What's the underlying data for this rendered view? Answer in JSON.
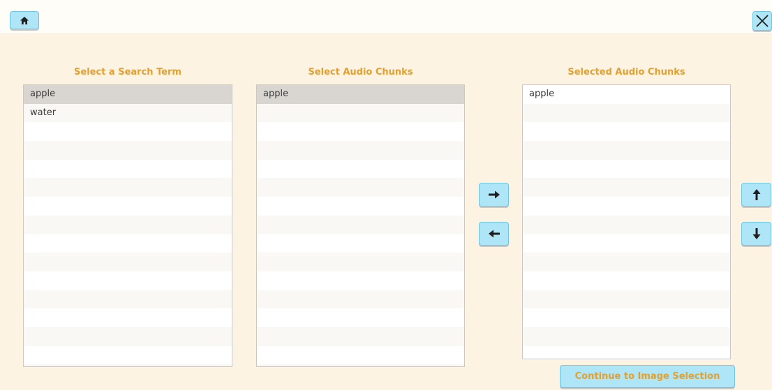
{
  "toolbar": {
    "home_icon": "home-icon",
    "close_icon": "close-icon"
  },
  "columns": {
    "search_terms": {
      "title": "Select a Search Term",
      "items": [
        "apple",
        "water"
      ],
      "selected": "apple"
    },
    "audio_chunks": {
      "title": "Select Audio Chunks",
      "items": [
        "apple"
      ],
      "selected": "apple"
    },
    "selected_chunks": {
      "title": "Selected Audio Chunks",
      "items": [
        "apple"
      ]
    }
  },
  "transfer": {
    "add_icon": "arrow-right-icon",
    "remove_icon": "arrow-left-icon"
  },
  "reorder": {
    "up_icon": "arrow-up-icon",
    "down_icon": "arrow-down-icon"
  },
  "continue_button": {
    "label": "Continue to Image Selection"
  },
  "colors": {
    "accent_text": "#e3a02e",
    "button_bg": "#aee6f7",
    "page_bg": "#fdf3e3",
    "selected_row": "#d9d6d2"
  }
}
